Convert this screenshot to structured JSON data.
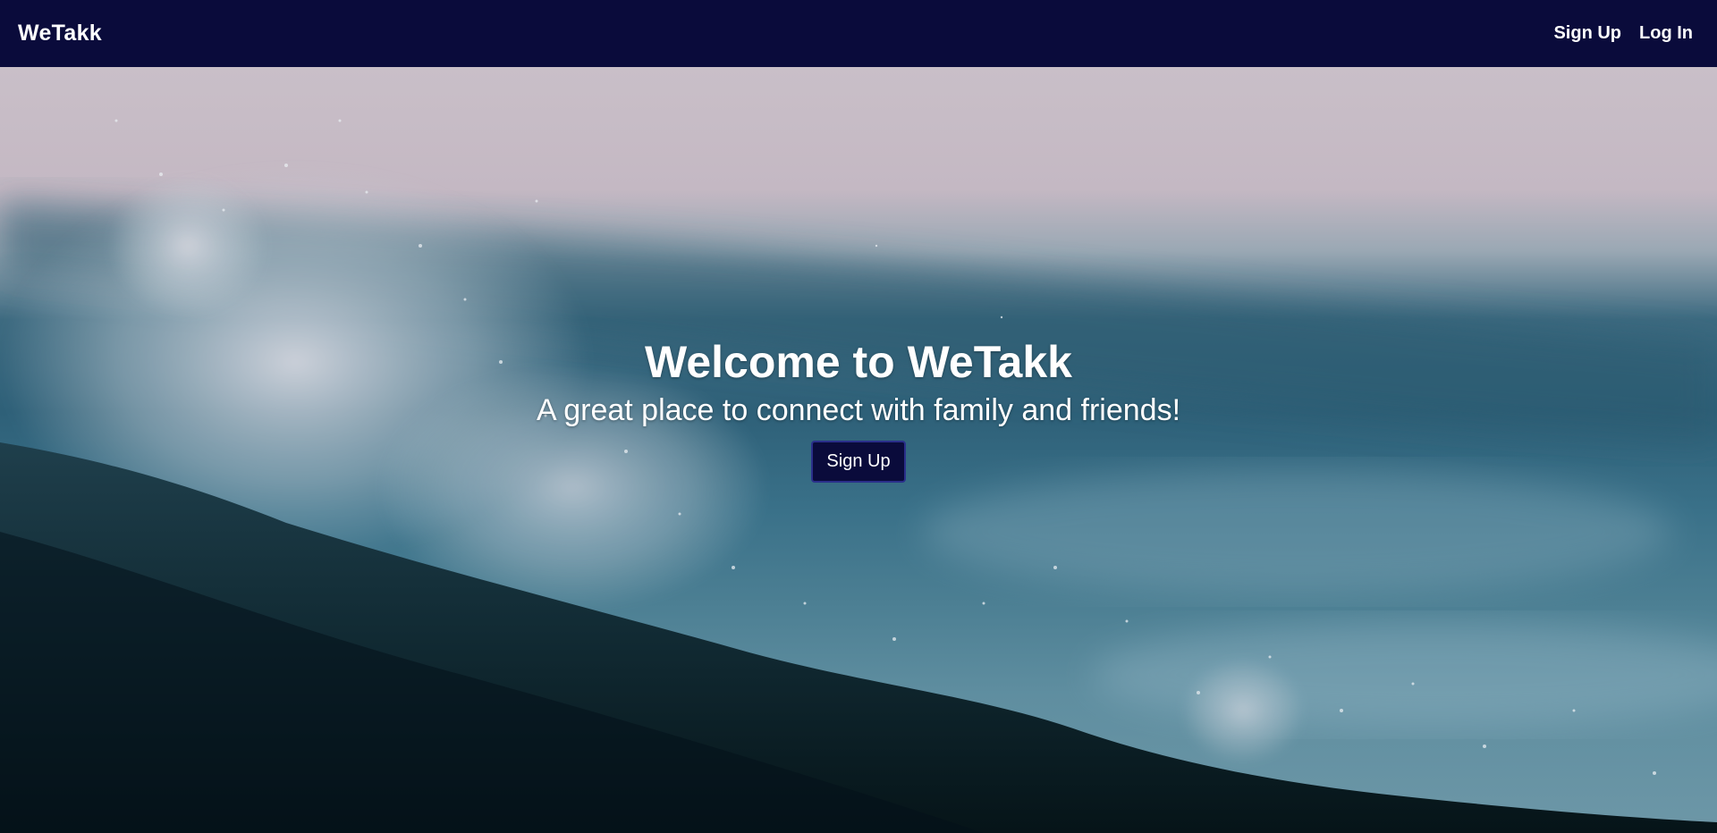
{
  "navbar": {
    "brand": "WeTakk",
    "links": [
      {
        "label": "Sign Up"
      },
      {
        "label": "Log In"
      }
    ],
    "background": "#0a0b3b"
  },
  "hero": {
    "title": "Welcome to WeTakk",
    "subtitle": "A great place to connect with family and friends!",
    "cta_label": "Sign Up",
    "background_image": "ocean-wave-splash"
  }
}
